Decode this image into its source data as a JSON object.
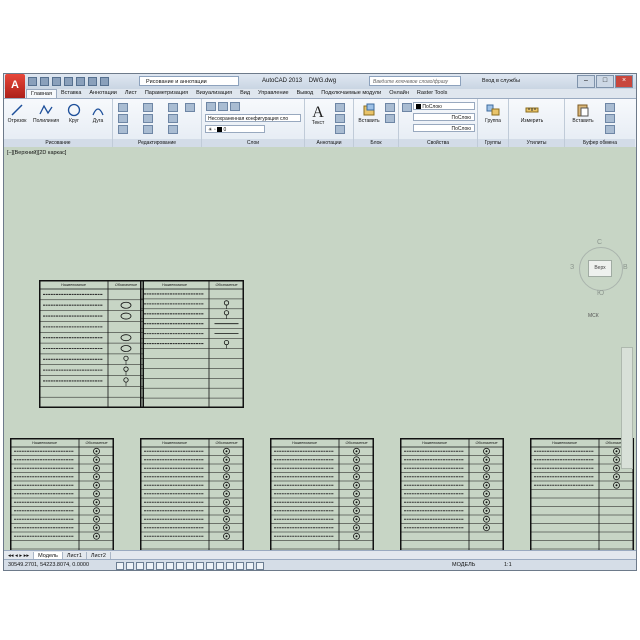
{
  "titlebar": {
    "workspace": "Рисование и аннотации",
    "app_title": "AutoCAD 2013",
    "doc_title": "DWG.dwg",
    "search_placeholder": "Введите ключевое слово/фразу",
    "signin": "Вход в службы"
  },
  "ribbon_tabs": [
    "Главная",
    "Вставка",
    "Аннотации",
    "Лист",
    "Параметризация",
    "Визуализация",
    "Вид",
    "Управление",
    "Вывод",
    "Подключаемые модули",
    "Онлайн",
    "Raster Tools"
  ],
  "ribbon": {
    "draw": {
      "tools": [
        "Отрезок",
        "Полилиния",
        "Круг",
        "Дуга"
      ],
      "title": "Рисование"
    },
    "modify": {
      "title": "Редактирование"
    },
    "layers": {
      "layer_state": "Несохраненная конфигурация сло",
      "color_index": "0",
      "title": "Слои"
    },
    "annotation": {
      "text": "Текст",
      "title": "Аннотации"
    },
    "block": {
      "insert": "Вставить",
      "title": "Блок"
    },
    "properties": {
      "color": "ПоСлою",
      "linetype": "ПоСлою",
      "lineweight": "ПоСлою",
      "title": "Свойства"
    },
    "groups": {
      "group": "Группа",
      "title": "Группы"
    },
    "utilities": {
      "measure": "Измерить",
      "title": "Утилиты"
    },
    "clipboard": {
      "paste": "Вставить",
      "title": "Буфер обмена"
    }
  },
  "viewport": {
    "label": "[–][Верхний][2D каркас]",
    "viewcube": {
      "top": "Верх",
      "north": "С",
      "south": "Ю",
      "west": "З",
      "east": "В",
      "wcs": "МСК"
    }
  },
  "sheet_header": {
    "name": "Наименование",
    "symbol": "Обозначение"
  },
  "layout_tabs": [
    "Модель",
    "Лист1",
    "Лист2"
  ],
  "status": {
    "coords": "30549.2701, 54223.8074, 0.0000",
    "model": "МОДЕЛЬ",
    "scale": "1:1"
  }
}
